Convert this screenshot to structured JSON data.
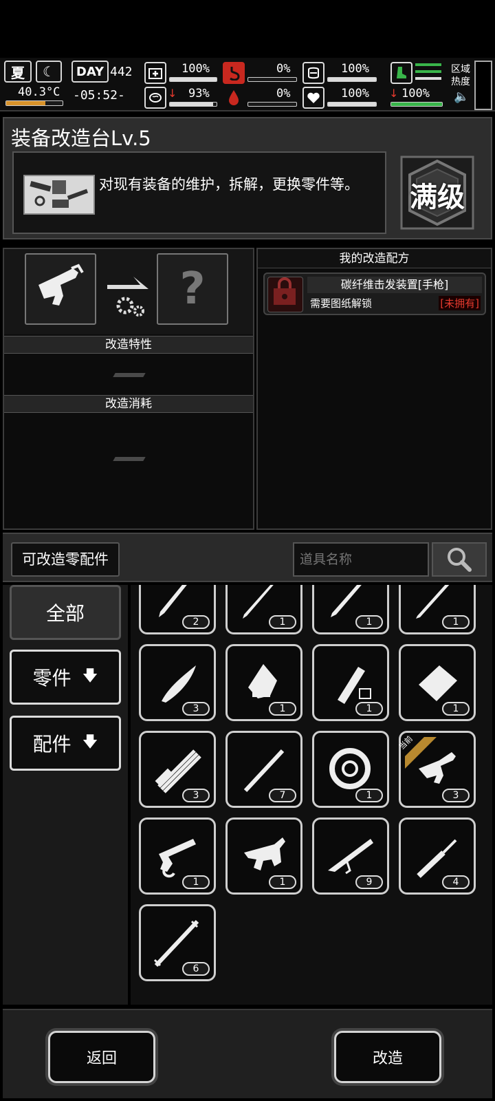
{
  "status": {
    "season": "夏",
    "temperature": "40.3°C",
    "day_label": "DAY",
    "day": "442",
    "time": "-05:52-",
    "health": "100%",
    "hunger": "0%",
    "armor": "100%",
    "stress": "93%",
    "thirst": "0%",
    "mood": "100%",
    "stamina": "100%",
    "zone_heat_label": "区域热度",
    "zone_heat_l1": "区域",
    "zone_heat_l2": "热度"
  },
  "header": {
    "title": "装备改造台Lv.5",
    "description": "对现有装备的维护，拆解，更换零件等。",
    "max_level": "满级"
  },
  "modify": {
    "traits_label": "改造特性",
    "cost_label": "改造消耗",
    "unknown": "?"
  },
  "recipes": {
    "title": "我的改造配方",
    "items": [
      {
        "name": "碳纤维击发装置[手枪]",
        "requirement": "需要图纸解锁",
        "status": "[未拥有]"
      }
    ]
  },
  "filter": {
    "parts_label": "可改造零配件",
    "search_placeholder": "道具名称"
  },
  "categories": {
    "all": "全部",
    "parts": "零件",
    "accessories": "配件"
  },
  "items": [
    {
      "name": "blade-1",
      "count": "2"
    },
    {
      "name": "blade-2",
      "count": "1"
    },
    {
      "name": "blade-3",
      "count": "1"
    },
    {
      "name": "blade-4",
      "count": "1"
    },
    {
      "name": "machete",
      "count": "3"
    },
    {
      "name": "axe-head",
      "count": "1"
    },
    {
      "name": "battery",
      "count": "1"
    },
    {
      "name": "plate",
      "count": "1"
    },
    {
      "name": "gatling",
      "count": "3"
    },
    {
      "name": "rod",
      "count": "7"
    },
    {
      "name": "drum",
      "count": "1"
    },
    {
      "name": "pistol-trigger",
      "count": "3",
      "current": true,
      "badge": "当前"
    },
    {
      "name": "pistol-frame",
      "count": "1"
    },
    {
      "name": "trigger-group",
      "count": "1"
    },
    {
      "name": "rifle-stock",
      "count": "9"
    },
    {
      "name": "silencer",
      "count": "4"
    },
    {
      "name": "barrel",
      "count": "6"
    }
  ],
  "footer": {
    "back": "返回",
    "modify": "改造"
  },
  "colors": {
    "accent_red": "#e53a2e",
    "stamina_green": "#39b54a",
    "badge_gold": "#b8892f"
  }
}
